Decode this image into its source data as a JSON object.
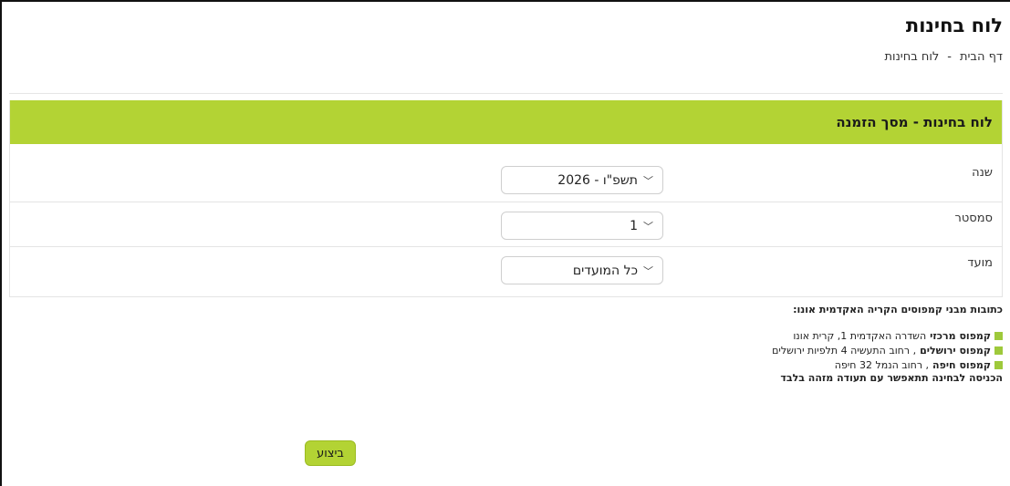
{
  "page": {
    "title": "לוח בחינות",
    "breadcrumb": {
      "home": "דף הבית",
      "separator": "-",
      "current": "לוח בחינות"
    }
  },
  "panel": {
    "header": "לוח בחינות - מסך הזמנה",
    "rows": [
      {
        "label": "שנה",
        "value": "2026 - תשפ\"ו"
      },
      {
        "label": "סמסטר",
        "value": "1"
      },
      {
        "label": "מועד",
        "value": "כל המועדים"
      }
    ]
  },
  "info": {
    "title": "כתובות מבני קמפוסים הקריה האקדמית אונו:",
    "campuses": [
      {
        "name": "קמפוס מרכזי",
        "address": "השדרה האקדמית 1, קרית אונו"
      },
      {
        "name": "קמפוס ירושלים",
        "address": ", רחוב התעשיה 4 תלפיות ירושלים"
      },
      {
        "name": "קמפוס חיפה",
        "address": ", רחוב הנמל 32 חיפה"
      }
    ],
    "note": "הכניסה לבחינה תתאפשר עם תעודה מזהה בלבד"
  },
  "actions": {
    "submit": "ביצוע"
  },
  "colors": {
    "accent": "#b3d334",
    "bullet": "#9ec93b"
  },
  "icons": {
    "select_chevron": "chevron-down-icon"
  }
}
